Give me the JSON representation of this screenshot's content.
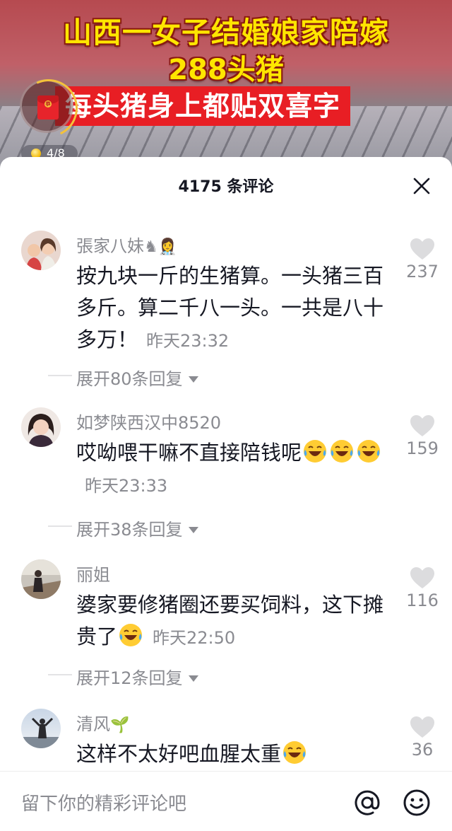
{
  "video": {
    "title_line1": "山西一女子结婚娘家陪嫁",
    "title_line2": "288头猪",
    "subtitle": "每头猪身上都贴双喜字",
    "redpacket_seal": "恭",
    "counter": "4/8"
  },
  "comments_panel": {
    "title": "4175 条评论",
    "comments": [
      {
        "username": "張家八妹",
        "name_emoji": "♞👩‍⚕️",
        "text": "按九块一斤的生猪算。一头猪三百多斤。算二千八一头。一共是八十多万！",
        "time": "昨天23:32",
        "likes": "237",
        "replies": "展开80条回复"
      },
      {
        "username": "如梦陕西汉中8520",
        "text": "哎呦喂干嘛不直接陪钱呢",
        "time": "昨天23:33",
        "likes": "159",
        "replies": "展开38条回复"
      },
      {
        "username": "丽姐",
        "text": "婆家要修猪圈还要买饲料，这下摊贵了",
        "time": "昨天22:50",
        "likes": "116",
        "replies": "展开12条回复"
      },
      {
        "username": "清风",
        "name_emoji": "🌱",
        "text": "这样不太好吧血腥太重",
        "likes": "36"
      }
    ]
  },
  "input": {
    "placeholder": "留下你的精彩评论吧",
    "value": ""
  },
  "icons": {
    "close": "close-icon",
    "like": "heart-icon",
    "at": "at-sign-icon",
    "emoji": "smile-icon",
    "laugh_emoji": "laughing-tears-emoji"
  },
  "colors": {
    "title_yellow": "#ffe600",
    "subtitle_red": "#e81e24",
    "text_primary": "#161823",
    "text_secondary": "#8a8b91"
  }
}
